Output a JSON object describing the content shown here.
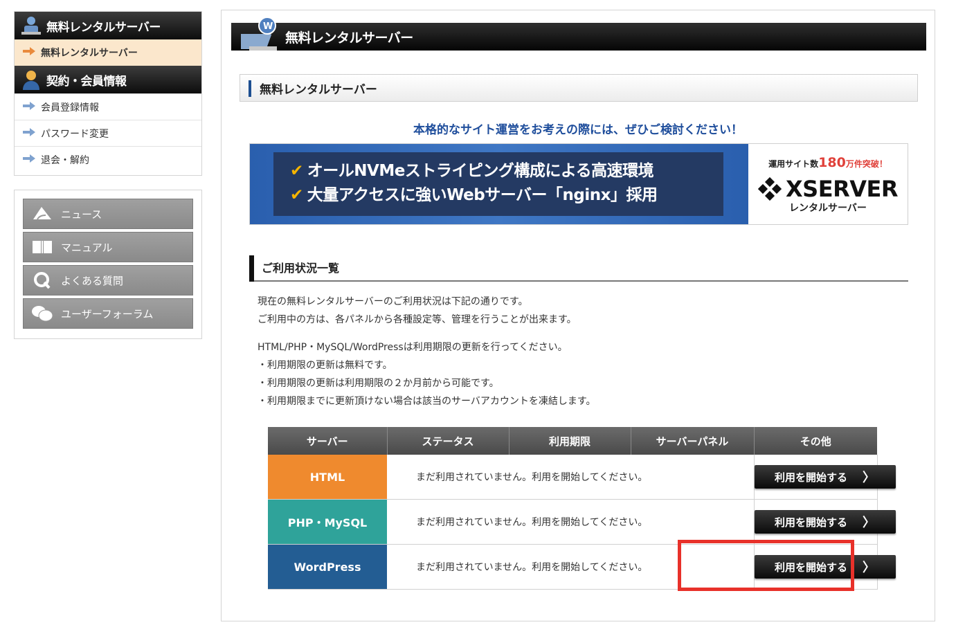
{
  "sidebar": {
    "menu_header_1": "無料レンタルサーバー",
    "menu_active_item": "無料レンタルサーバー",
    "menu_header_2": "契約・会員情報",
    "items": [
      {
        "label": "会員登録情報"
      },
      {
        "label": "パスワード変更"
      },
      {
        "label": "退会・解約"
      }
    ],
    "links": [
      {
        "label": "ニュース",
        "icon": "megaphone-icon"
      },
      {
        "label": "マニュアル",
        "icon": "book-icon"
      },
      {
        "label": "よくある質問",
        "icon": "q-icon"
      },
      {
        "label": "ユーザーフォーラム",
        "icon": "chat-bubbles-icon"
      }
    ]
  },
  "main": {
    "title": "無料レンタルサーバー",
    "subtitle": "無料レンタルサーバー",
    "promo_text": "本格的なサイト運営をお考えの際には、ぜひご検討ください！",
    "banner": {
      "line1": "オールNVMeストライピング構成による高速環境",
      "line2": "大量アクセスに強いWebサーバー「nginx」採用",
      "top_prefix": "運用サイト数",
      "top_number": "180",
      "top_suffix": "万件突破！",
      "logo": "XSERVER",
      "logo_sub": "レンタルサーバー"
    },
    "section_title": "ご利用状況一覧",
    "para1_line1": "現在の無料レンタルサーバーのご利用状況は下記の通りです。",
    "para1_line2": "ご利用中の方は、各パネルから各種設定等、管理を行うことが出来ます。",
    "para2_line1": "HTML/PHP・MySQL/WordPressは利用期限の更新を行ってください。",
    "para2_line2": "・利用期限の更新は無料です。",
    "para2_line3": "・利用期限の更新は利用期限の２か月前から可能です。",
    "para2_line4": "・利用期限までに更新頂けない場合は該当のサーバアカウントを凍結します。",
    "table": {
      "headers": [
        "サーバー",
        "ステータス",
        "利用期限",
        "サーバーパネル",
        "その他"
      ],
      "rows": [
        {
          "server": "HTML",
          "message": "まだ利用されていません。利用を開始してください。",
          "button": "利用を開始する",
          "color": "#ef8a2e"
        },
        {
          "server": "PHP・MySQL",
          "message": "まだ利用されていません。利用を開始してください。",
          "button": "利用を開始する",
          "color": "#2fa39a"
        },
        {
          "server": "WordPress",
          "message": "まだ利用されていません。利用を開始してください。",
          "button": "利用を開始する",
          "color": "#235d93"
        }
      ]
    },
    "highlight_color": "#e8312a"
  }
}
